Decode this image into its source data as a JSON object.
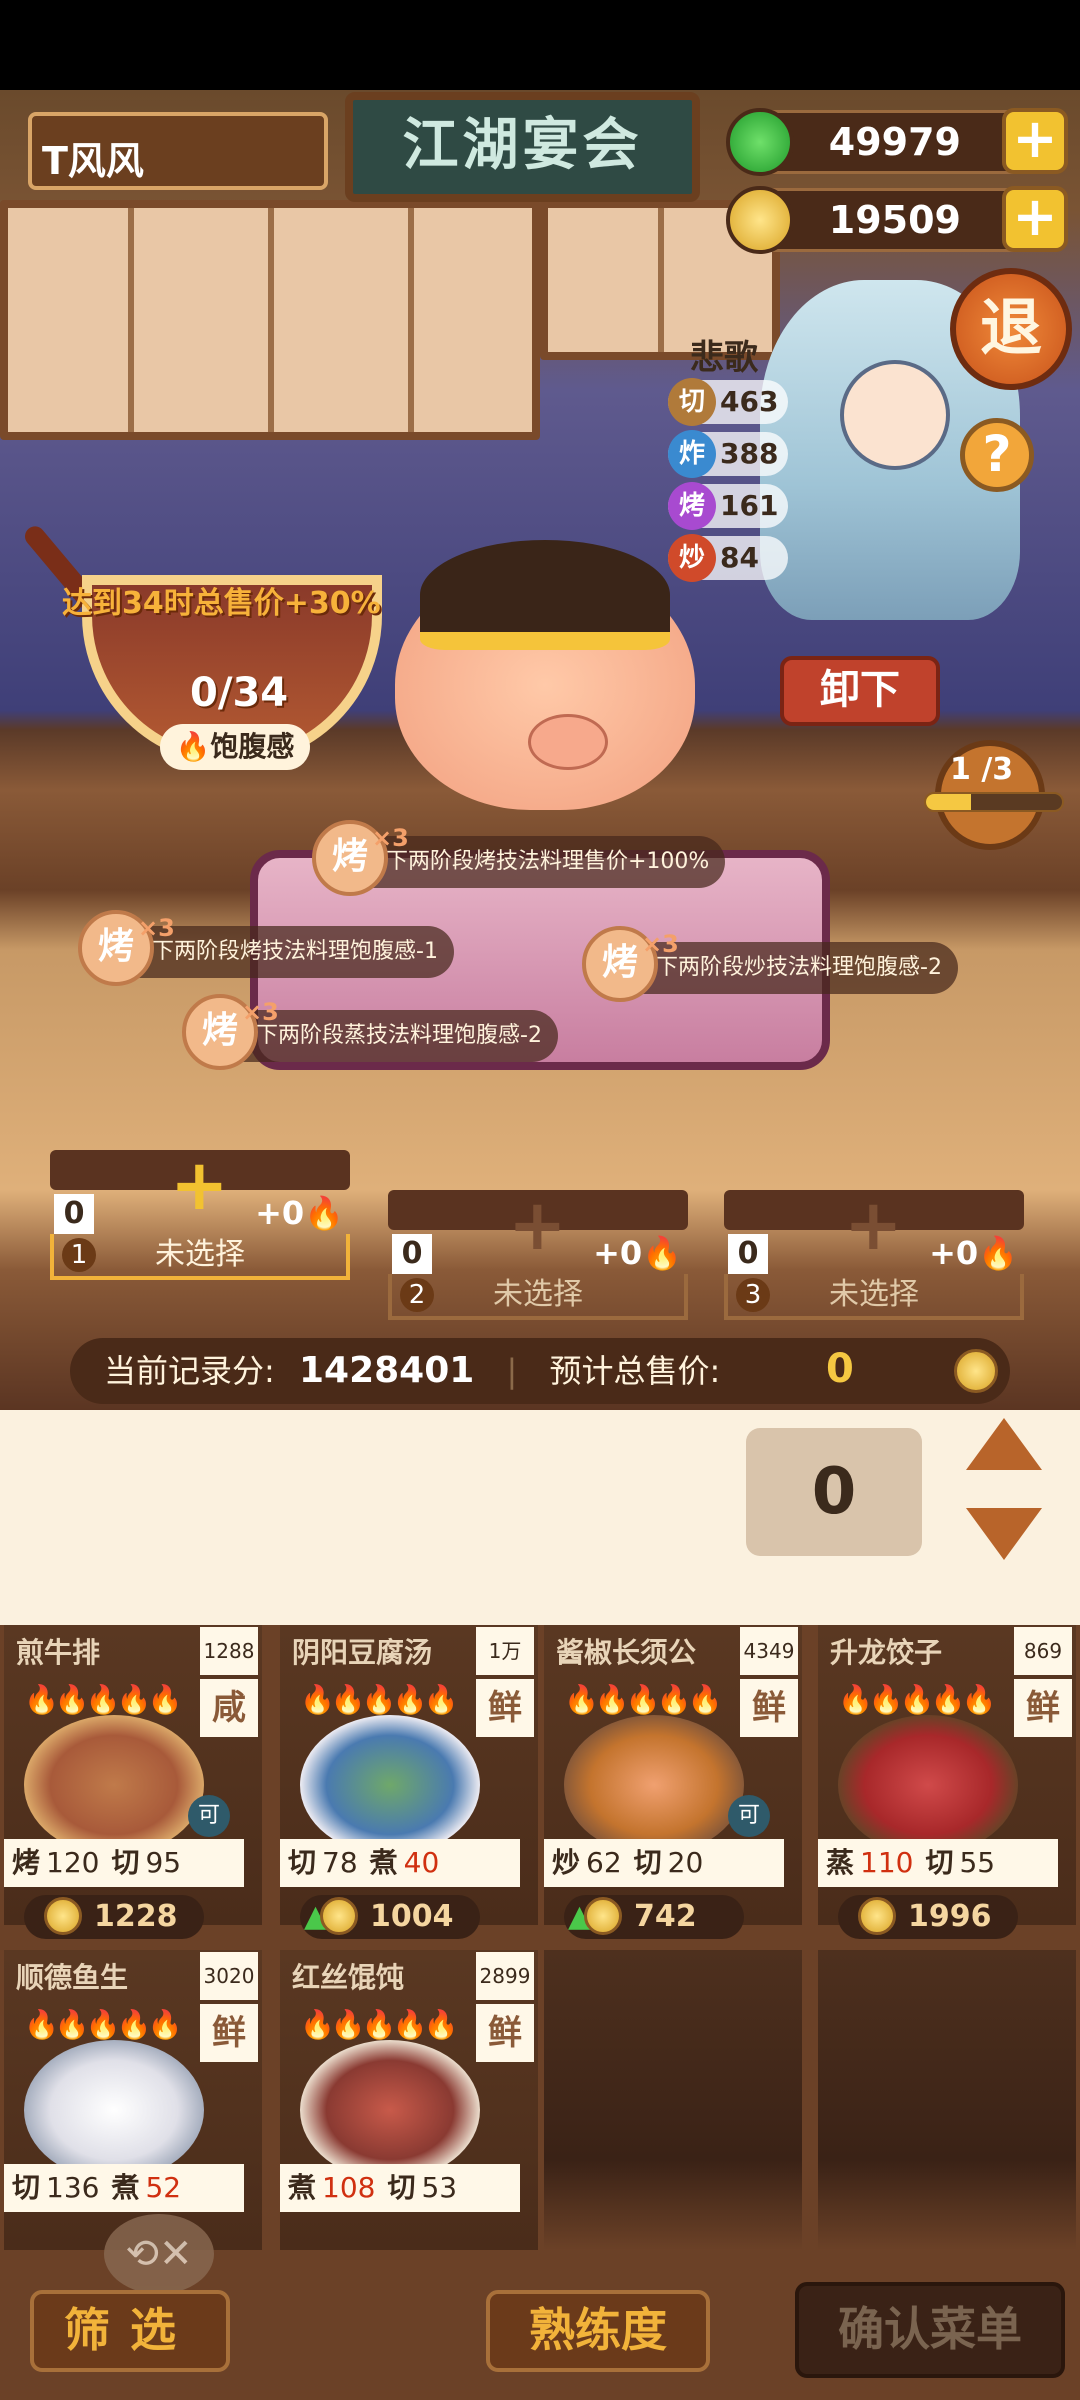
{
  "header": {
    "player_name": "T风风",
    "title": "江湖宴会",
    "jade": "49979",
    "gold": "19509",
    "exit_label": "退",
    "help_label": "?"
  },
  "chef": {
    "name": "悲歌",
    "skills": [
      {
        "icon": "切",
        "value": "463",
        "color": "#b07a3a"
      },
      {
        "icon": "炸",
        "value": "388",
        "color": "#3a8ad0"
      },
      {
        "icon": "烤",
        "value": "161",
        "color": "#a84ad0"
      },
      {
        "icon": "炒",
        "value": "84",
        "color": "#d04a2a"
      }
    ],
    "unload_label": "卸下"
  },
  "satiety": {
    "bonus_text": "达到34时总售价+30%",
    "count": "0/34",
    "label": "饱腹感"
  },
  "stage": {
    "text": "1 /3",
    "progress_fraction": 0.33
  },
  "buffs": [
    {
      "icon": "烤",
      "mult": "×3",
      "text": "下两阶段烤技法料理售价+100%"
    },
    {
      "icon": "烤",
      "mult": "×3",
      "text": "下两阶段烤技法料理饱腹感-1"
    },
    {
      "icon": "烤",
      "mult": "×3",
      "text": "下两阶段炒技法料理饱腹感-2"
    },
    {
      "icon": "烤",
      "mult": "×3",
      "text": "下两阶段蒸技法料理饱腹感-2"
    }
  ],
  "slots": [
    {
      "num": "1",
      "qty": "0",
      "fire": "+0",
      "label": "未选择",
      "active": true
    },
    {
      "num": "2",
      "qty": "0",
      "fire": "+0",
      "label": "未选择",
      "active": false
    },
    {
      "num": "3",
      "qty": "0",
      "fire": "+0",
      "label": "未选择",
      "active": false
    }
  ],
  "score": {
    "record_label": "当前记录分:",
    "record_value": "1428401",
    "total_label": "预计总售价:",
    "total_value": "0"
  },
  "quantity": {
    "value": "0"
  },
  "dishes": [
    {
      "name": "煎牛排",
      "price": "1288",
      "taste": "咸",
      "fire": "🔥🔥🔥🔥🔥",
      "s1": "烤",
      "v1": "120",
      "s2": "切",
      "v2": "95",
      "v2red": false,
      "coin": "1228",
      "dish_color": "#a85a3a",
      "can": "可"
    },
    {
      "name": "阴阳豆腐汤",
      "price": "1万",
      "taste": "鲜",
      "fire": "🔥🔥🔥🔥🔥",
      "s1": "切",
      "v1": "78",
      "s2": "煮",
      "v2": "40",
      "v2red": true,
      "coin": "1004",
      "dish_color": "#4a7ab0",
      "can": ""
    },
    {
      "name": "酱椒长须公",
      "price": "4349",
      "taste": "鲜",
      "fire": "🔥🔥🔥🔥🔥",
      "s1": "炒",
      "v1": "62",
      "s2": "切",
      "v2": "20",
      "v2red": false,
      "coin": "742",
      "dish_color": "#c4742e",
      "can": "可"
    },
    {
      "name": "升龙饺子",
      "price": "869",
      "taste": "鲜",
      "fire": "🔥🔥🔥🔥🔥",
      "s1": "蒸",
      "v1": "110",
      "s2": "切",
      "v2": "55",
      "v2red": false,
      "coin": "1996",
      "dish_color": "#a8282a",
      "can": ""
    },
    {
      "name": "顺德鱼生",
      "price": "3020",
      "taste": "鲜",
      "fire": "🔥🔥🔥🔥🔥",
      "s1": "切",
      "v1": "136",
      "s2": "煮",
      "v2": "52",
      "v2red": true,
      "coin": "",
      "dish_color": "#e0e0e8",
      "can": ""
    },
    {
      "name": "红丝馄饨",
      "price": "2899",
      "taste": "鲜",
      "fire": "🔥🔥🔥🔥🔥",
      "s1": "煮",
      "v1": "108",
      "s2": "切",
      "v2": "53",
      "v2red": false,
      "coin": "",
      "dish_color": "#8a3a32",
      "can": ""
    }
  ],
  "bottom": {
    "filter_label": "筛选",
    "skill_label": "熟练度",
    "confirm_label": "确认菜单"
  }
}
